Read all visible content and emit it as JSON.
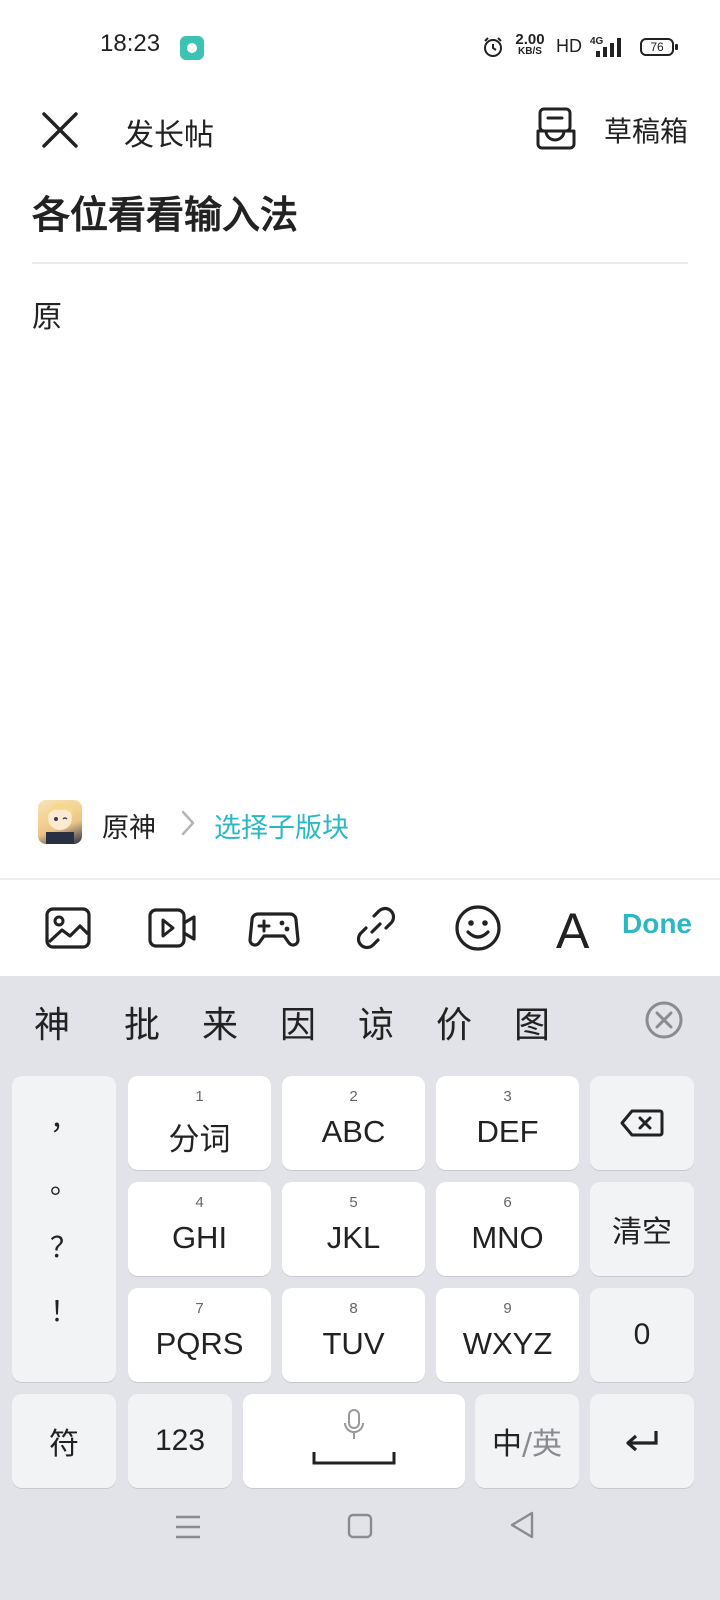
{
  "status_bar": {
    "time": "18:23",
    "net_speed_value": "2.00",
    "net_speed_unit": "KB/S",
    "hd": "HD",
    "network": "4G",
    "battery": "76"
  },
  "header": {
    "title": "发长帖",
    "draft_label": "草稿箱"
  },
  "post": {
    "title": "各位看看输入法",
    "body": "原"
  },
  "forum": {
    "name": "原神",
    "sub_section": "选择子版块"
  },
  "toolbar": {
    "icons": [
      "image-icon",
      "video-icon",
      "gamepad-icon",
      "link-icon",
      "emoji-icon",
      "text-format-icon"
    ],
    "text_format_glyph": "A",
    "done_label": "Done",
    "accent_color": "#2ab8c3"
  },
  "keyboard": {
    "candidates": [
      "神",
      "批",
      "来",
      "因",
      "谅",
      "价",
      "图"
    ],
    "punctuation": [
      "，",
      "。",
      "？",
      "！"
    ],
    "keys": [
      {
        "num": "1",
        "label": "分词"
      },
      {
        "num": "2",
        "label": "ABC"
      },
      {
        "num": "3",
        "label": "DEF"
      },
      {
        "num": "4",
        "label": "GHI"
      },
      {
        "num": "5",
        "label": "JKL"
      },
      {
        "num": "6",
        "label": "MNO"
      },
      {
        "num": "7",
        "label": "PQRS"
      },
      {
        "num": "8",
        "label": "TUV"
      },
      {
        "num": "9",
        "label": "WXYZ"
      }
    ],
    "clear_label": "清空",
    "zero_label": "0",
    "symbol_label": "符",
    "numeric_label": "123",
    "lang_primary": "中",
    "lang_separator": "/",
    "lang_secondary": "英"
  }
}
